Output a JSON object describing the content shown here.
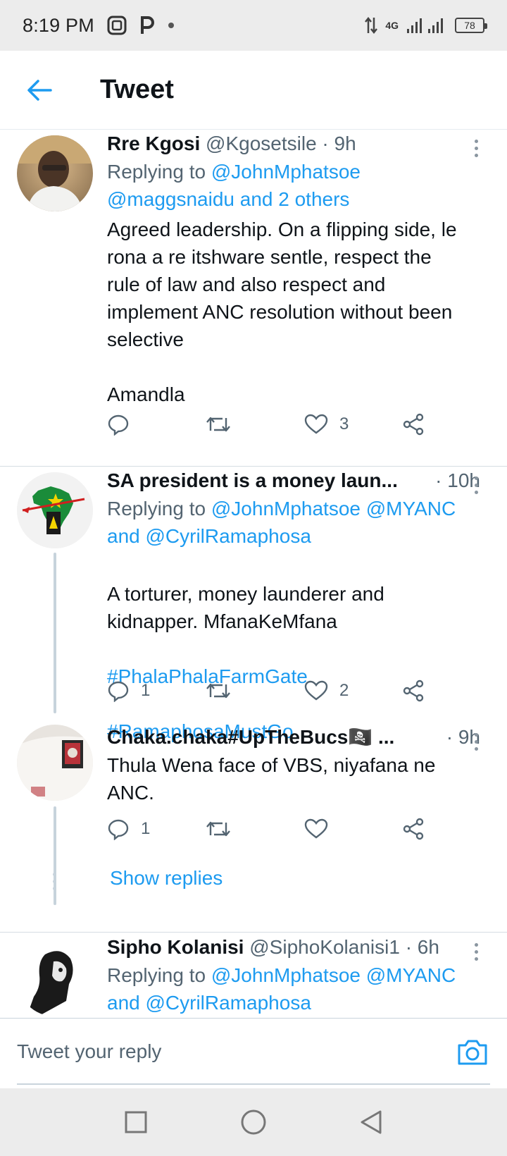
{
  "status_bar": {
    "time": "8:19 PM",
    "network": "4G",
    "battery": "78"
  },
  "header": {
    "title": "Tweet"
  },
  "tweets": [
    {
      "name": "Rre Kgosi",
      "handle": "@Kgosetsile",
      "time": "· 9h",
      "replying_prefix": "Replying to ",
      "replying_line1": "@JohnMphatsoe",
      "replying_line2": "@maggsnaidu and 2 others",
      "text": "Agreed leadership. On a flipping side, le\nrona a re itshware sentle, respect the\nrule of law and also respect and\nimplement ANC resolution without been\nselective\n\nAmandla",
      "reply_count": "",
      "retweet_count": "",
      "like_count": "3"
    },
    {
      "name": "SA president is a money laun...",
      "handle": "",
      "time": "· 10h",
      "replying_prefix": "Replying to ",
      "replying_line1": "@JohnMphatsoe @MYANC",
      "replying_line2": "and @CyrilRamaphosa",
      "text": "A torturer, money launderer and\nkidnapper. MfanaKeMfana",
      "hashtag1": "#PhalaPhalaFarmGate",
      "hashtag2": "#RamaphosaMustGo",
      "reply_count": "1",
      "retweet_count": "",
      "like_count": "2"
    },
    {
      "name": "Chaka.chaka#UpTheBucs🏴‍☠️ ...",
      "handle": "",
      "time": "· 9h",
      "text": "Thula Wena face of VBS, niyafana ne\nANC.",
      "reply_count": "1",
      "retweet_count": "",
      "like_count": ""
    },
    {
      "name": "Sipho Kolanisi",
      "handle": "@SiphoKolanisi1",
      "time": "· 6h",
      "replying_prefix": "Replying to ",
      "replying_line1": "@JohnMphatsoe @MYANC",
      "replying_line2": "and @CyrilRamaphosa"
    }
  ],
  "show_replies": "Show replies",
  "reply_bar": {
    "placeholder": "Tweet your reply"
  },
  "icons": {
    "back": "arrow-left-icon",
    "more": "more-vertical-icon",
    "reply": "reply-icon",
    "retweet": "retweet-icon",
    "like": "heart-icon",
    "share": "share-icon",
    "camera": "camera-icon"
  },
  "colors": {
    "accent": "#1d9bf0",
    "text": "#0f1419",
    "secondary": "#536471"
  }
}
